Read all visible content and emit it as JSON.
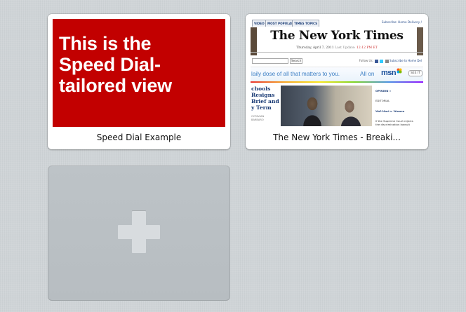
{
  "speed_dial": {
    "tiles": [
      {
        "title": "Speed Dial Example",
        "thumbnail_text": "This is the\nSpeed Dial-\ntailored view",
        "thumbnail_color": "#c20000"
      },
      {
        "title": "The New York Times - Breaki...",
        "thumbnail": {
          "tabs": [
            "VIDEO",
            "MOST POPULAR",
            "TIMES TOPICS"
          ],
          "top_right": "Subscribe: Home Delivery /",
          "masthead": "The New York Times",
          "date": "Thursday, April 7, 2011",
          "last_update_label": "Last Update:",
          "last_update_time": "12:12 PM ET",
          "search_button": "Search",
          "follow_us": "Follow Us:",
          "subscribe_home": "Subscribe to Home Del",
          "ad_text": "laily dose of all that matters to you.",
          "ad_all_on": "All on",
          "ad_brand": "msn",
          "ad_cta": "SEE IT",
          "headline": "chools\nResigns\nBrief and\ny Term",
          "byline": "OCTAVIAN\nBARBARO",
          "opinion_label": "OPINION »",
          "opinion_section": "EDITORIAL",
          "opinion_head": "Wal-Mart v. Women",
          "opinion_body": "If the Supreme Court rejects\nthe discrimination lawsuit\nagainst Wal-Mart, it will send\na chilling message that some\ncompanies are too big to"
        }
      }
    ],
    "add_tile": {
      "icon": "plus-icon"
    }
  },
  "colors": {
    "background": "#cfd4d7",
    "tile_background": "#ffffff",
    "add_tile_background": "#bdc3c7",
    "plus_color": "#d8dcdf"
  }
}
